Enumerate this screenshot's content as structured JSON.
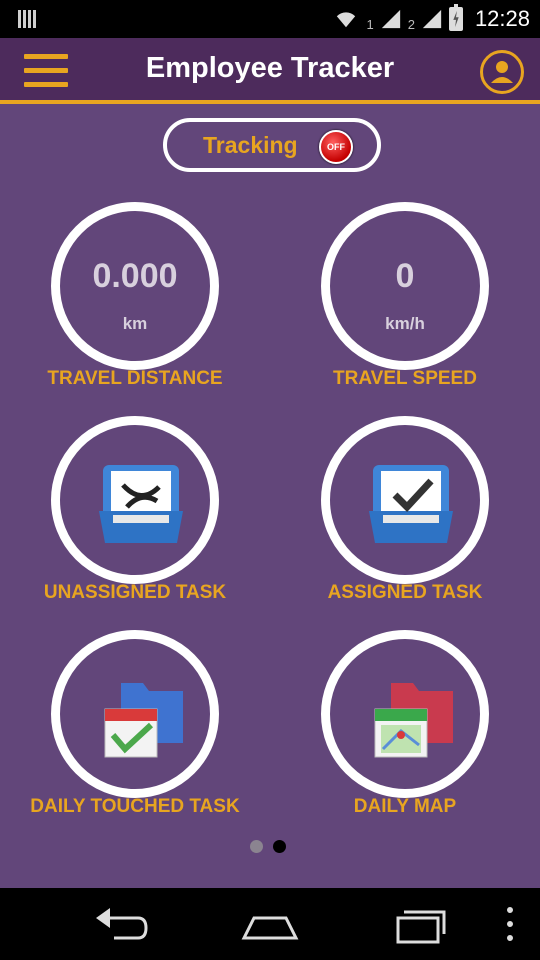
{
  "status_bar": {
    "sim1_label": "1",
    "sim2_label": "2",
    "time": "12:28",
    "icons": [
      "barcode-icon",
      "wifi-icon",
      "signal-icon",
      "battery-charging-icon"
    ]
  },
  "app_bar": {
    "title": "Employee Tracker",
    "menu_icon": "hamburger-menu-icon",
    "profile_icon": "user-profile-icon"
  },
  "tracking": {
    "label": "Tracking",
    "toggle_text": "OFF"
  },
  "tiles": {
    "distance": {
      "value": "0.000",
      "unit": "km",
      "label": "TRAVEL DISTANCE"
    },
    "speed": {
      "value": "0",
      "unit": "km/h",
      "label": "TRAVEL SPEED"
    },
    "unassigned": {
      "label": "UNASSIGNED TASK",
      "icon": "inbox-x-icon"
    },
    "assigned": {
      "label": "ASSIGNED TASK",
      "icon": "inbox-check-icon"
    },
    "daily_touched": {
      "label": "DAILY TOUCHED TASK",
      "icon": "folder-calendar-icon"
    },
    "daily_map": {
      "label": "DAILY MAP",
      "icon": "folder-map-icon"
    }
  },
  "pager": {
    "page_count": 2,
    "active_page": 2
  },
  "nav_bar": {
    "icons": [
      "back-icon",
      "home-icon",
      "recents-icon",
      "overflow-menu-icon"
    ]
  },
  "colors": {
    "accent": "#e8a520",
    "app_bar_bg": "#4d2b5c",
    "main_bg": "#62467a",
    "off_button": "#d60000"
  }
}
